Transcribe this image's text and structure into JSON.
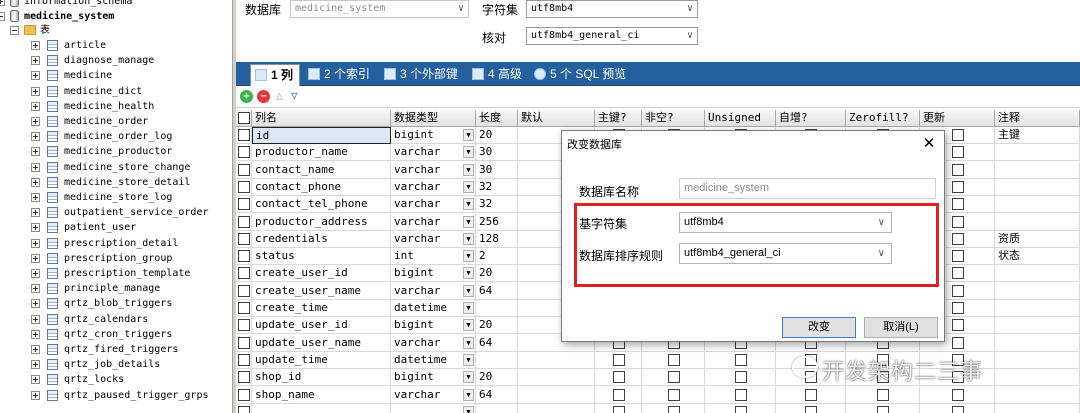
{
  "tree": {
    "top_items": [
      {
        "label": "information_schema",
        "bold": false
      },
      {
        "label": "medicine_system",
        "bold": true
      }
    ],
    "tables_folder": "表",
    "tables": [
      "article",
      "diagnose_manage",
      "medicine",
      "medicine_dict",
      "medicine_health",
      "medicine_order",
      "medicine_order_log",
      "medicine_productor",
      "medicine_store_change",
      "medicine_store_detail",
      "medicine_store_log",
      "outpatient_service_order",
      "patient_user",
      "prescription_detail",
      "prescription_group",
      "prescription_template",
      "principle_manage",
      "qrtz_blob_triggers",
      "qrtz_calendars",
      "qrtz_cron_triggers",
      "qrtz_fired_triggers",
      "qrtz_job_details",
      "qrtz_locks",
      "qrtz_paused_trigger_grps"
    ]
  },
  "form": {
    "database_label": "数据库",
    "database_value": "medicine_system",
    "charset_label": "字符集",
    "charset_value": "utf8mb4",
    "collation_label": "核对",
    "collation_value": "utf8mb4_general_ci"
  },
  "tabs": [
    "1 列",
    "2 个索引",
    "3 个外部键",
    "4 高级",
    "5 个 SQL 预览"
  ],
  "grid": {
    "headers": [
      "列名",
      "数据类型",
      "长度",
      "默认",
      "主键?",
      "非空?",
      "Unsigned",
      "自增?",
      "Zerofill?",
      "更新",
      "注释"
    ],
    "rows": [
      {
        "name": "id",
        "type": "bigint",
        "len": "20",
        "comment": "主键"
      },
      {
        "name": "productor_name",
        "type": "varchar",
        "len": "30",
        "comment": ""
      },
      {
        "name": "contact_name",
        "type": "varchar",
        "len": "30",
        "comment": ""
      },
      {
        "name": "contact_phone",
        "type": "varchar",
        "len": "32",
        "comment": ""
      },
      {
        "name": "contact_tel_phone",
        "type": "varchar",
        "len": "32",
        "comment": ""
      },
      {
        "name": "productor_address",
        "type": "varchar",
        "len": "256",
        "comment": ""
      },
      {
        "name": "credentials",
        "type": "varchar",
        "len": "128",
        "comment": "资质"
      },
      {
        "name": "status",
        "type": "int",
        "len": "2",
        "comment": "状态"
      },
      {
        "name": "create_user_id",
        "type": "bigint",
        "len": "20",
        "comment": ""
      },
      {
        "name": "create_user_name",
        "type": "varchar",
        "len": "64",
        "comment": ""
      },
      {
        "name": "create_time",
        "type": "datetime",
        "len": "",
        "comment": ""
      },
      {
        "name": "update_user_id",
        "type": "bigint",
        "len": "20",
        "comment": ""
      },
      {
        "name": "update_user_name",
        "type": "varchar",
        "len": "64",
        "comment": ""
      },
      {
        "name": "update_time",
        "type": "datetime",
        "len": "",
        "comment": ""
      },
      {
        "name": "shop_id",
        "type": "bigint",
        "len": "20",
        "comment": ""
      },
      {
        "name": "shop_name",
        "type": "varchar",
        "len": "64",
        "comment": ""
      },
      {
        "name": "",
        "type": "",
        "len": "",
        "comment": ""
      }
    ]
  },
  "dialog": {
    "title": "改变数据库",
    "db_name_label": "数据库名称",
    "db_name_value": "medicine_system",
    "charset_label": "基字符集",
    "charset_value": "utf8mb4",
    "collation_label": "数据库排序规则",
    "collation_value": "utf8mb4_general_ci",
    "ok_label": "改变",
    "cancel_label": "取消(L)"
  },
  "watermark": "开发架构二三事",
  "colors": {
    "tabbar": "#25609e",
    "highlight": "#e02020"
  }
}
